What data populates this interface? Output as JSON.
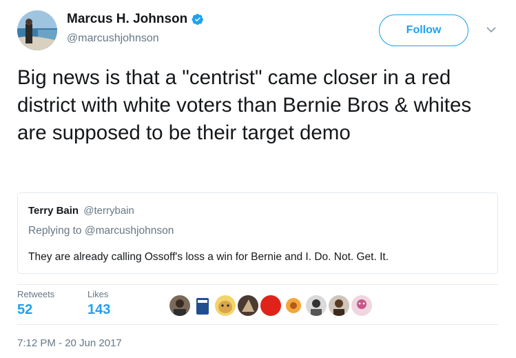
{
  "author": {
    "name": "Marcus H. Johnson",
    "handle": "@marcushjohnson",
    "verified": true
  },
  "follow_label": "Follow",
  "tweet_text": "Big news is that a \"centrist\" came closer in a red district with white voters than Bernie Bros & whites are supposed to be their target demo",
  "quoted": {
    "name": "Terry Bain",
    "handle": "@terrybain",
    "reply_to": "Replying to @marcushjohnson",
    "text": "They are already calling Ossoff's loss a win for Bernie and I. Do. Not. Get. It."
  },
  "stats": {
    "retweets_label": "Retweets",
    "retweets": "52",
    "likes_label": "Likes",
    "likes": "143"
  },
  "timestamp": "7:12 PM - 20 Jun 2017",
  "colors": {
    "accent": "#1da1f2",
    "secondary_text": "#657786",
    "border": "#e1e8ed"
  },
  "icons": [
    "verified-badge-icon",
    "chevron-down-icon"
  ]
}
